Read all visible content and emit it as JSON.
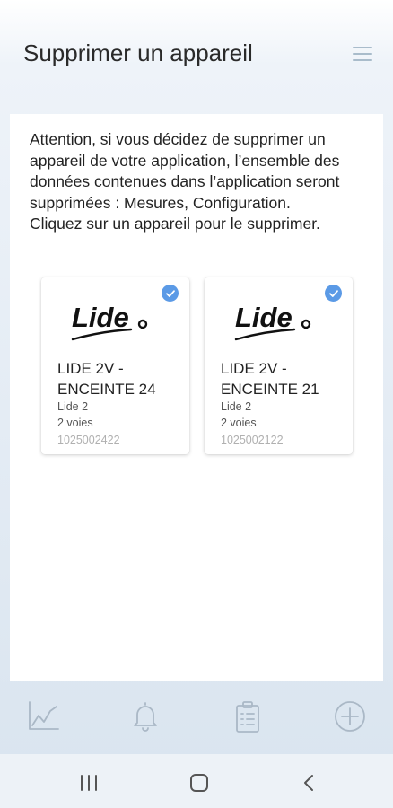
{
  "header": {
    "title": "Supprimer un appareil",
    "menu_icon": "hamburger-menu-icon"
  },
  "message": {
    "warning": "Attention, si vous décidez de supprimer un appareil de votre application, l’ensemble des données contenues dans l’application seront supprimées : Mesures, Configuration.",
    "instruction": "Cliquez sur un appareil pour le supprimer."
  },
  "devices": [
    {
      "logo_text": "Lide",
      "name": "LIDE 2V - ENCEINTE 24",
      "model": "Lide 2",
      "channels": "2 voies",
      "serial": "1025002422",
      "selected": true
    },
    {
      "logo_text": "Lide",
      "name": "LIDE 2V - ENCEINTE 21",
      "model": "Lide 2",
      "channels": "2 voies",
      "serial": "1025002122",
      "selected": true
    }
  ],
  "tabbar": [
    "chart-icon",
    "bell-icon",
    "clipboard-icon",
    "add-circle-icon"
  ],
  "system_nav": [
    "recent-apps-icon",
    "home-icon",
    "back-icon"
  ],
  "colors": {
    "accent": "#5b9ae6",
    "icon_gray": "#aab8c6"
  }
}
